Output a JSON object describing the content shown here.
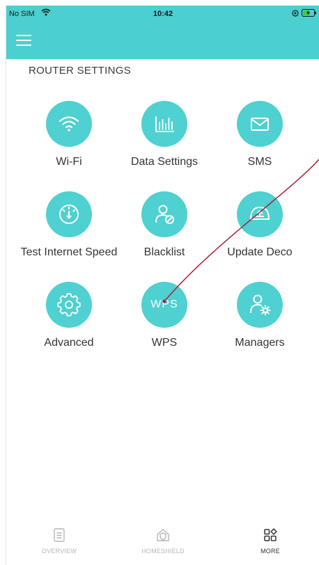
{
  "status_bar": {
    "carrier": "No SIM",
    "time": "10:42"
  },
  "section_title": "ROUTER SETTINGS",
  "tiles": [
    {
      "label": "Wi-Fi",
      "icon": "wifi-icon"
    },
    {
      "label": "Data Settings",
      "icon": "bar-chart-icon"
    },
    {
      "label": "SMS",
      "icon": "envelope-icon"
    },
    {
      "label": "Test Internet Speed",
      "icon": "speedometer-icon"
    },
    {
      "label": "Blacklist",
      "icon": "blocked-user-icon"
    },
    {
      "label": "Update Deco",
      "icon": "update-device-icon"
    },
    {
      "label": "Advanced",
      "icon": "gear-icon"
    },
    {
      "label": "WPS",
      "icon": "wps-text",
      "icon_text": "WPS"
    },
    {
      "label": "Managers",
      "icon": "manager-user-icon"
    }
  ],
  "tabbar": {
    "overview": "OVERVIEW",
    "homeshield": "HOMESHIELD",
    "more": "MORE",
    "active": "more"
  },
  "colors": {
    "header": "#4ccfcf",
    "icon_circle": "#4fd0d1",
    "pointer": "#a3213a"
  }
}
